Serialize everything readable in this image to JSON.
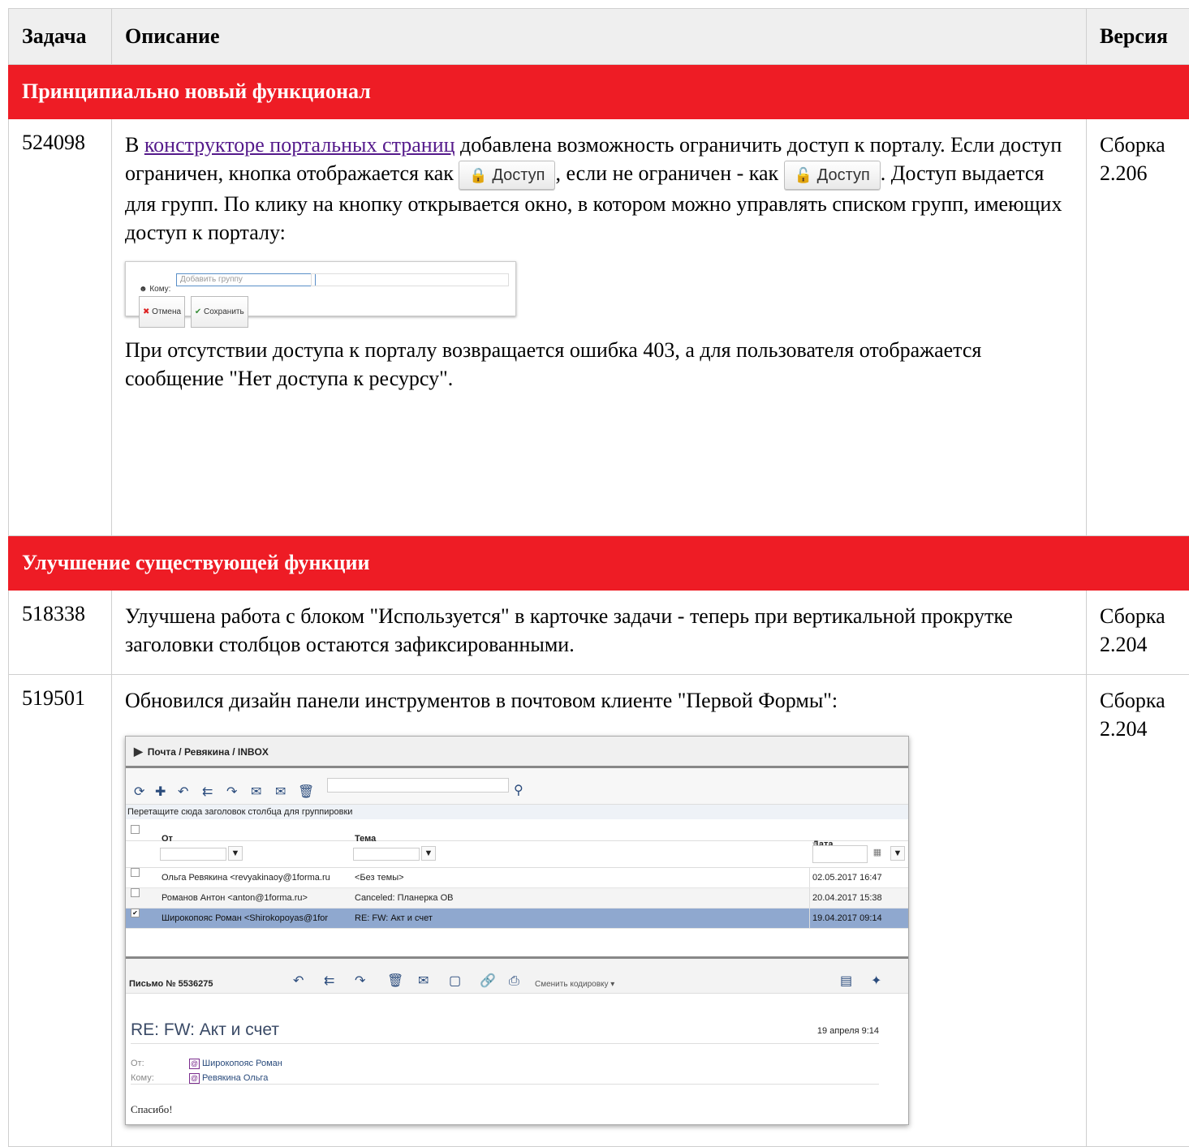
{
  "table": {
    "headers": {
      "task": "Задача",
      "description": "Описание",
      "version": "Версия"
    }
  },
  "sections": [
    {
      "title": "Принципиально новый функционал"
    },
    {
      "title": "Улучшение существующей функции"
    }
  ],
  "rows": {
    "r1": {
      "task": "524098",
      "text_before_link": "В ",
      "link": "конструкторе портальных страниц",
      "text_after_link": " добавлена возможность ограничить доступ к порталу. Если доступ ограничен, кнопка отображается как ",
      "button_locked": "Доступ",
      "text_mid": ", если не ограничен - как ",
      "button_unlocked": "Доступ",
      "text_end": ". Доступ выдается для групп. По клику на кнопку открывается окно, в котором можно управлять списком групп, имеющих доступ к порталу:",
      "dialog": {
        "to_label": "Кому:",
        "placeholder": "Добавить группу",
        "cancel": "Отмена",
        "save": "Сохранить"
      },
      "text_after": "При отсутствии доступа к порталу возвращается ошибка 403, а для пользователя отображается сообщение \"Нет доступа к ресурсу\".",
      "version": "Сборка 2.206"
    },
    "r2": {
      "task": "518338",
      "text": "Улучшена работа с блоком \"Используется\" в карточке задачи - теперь при вертикальной прокрутке заголовки столбцов остаются зафиксированными.",
      "version": "Сборка 2.204"
    },
    "r3": {
      "task": "519501",
      "text": "Обновился дизайн панели инструментов в почтовом клиенте \"Первой Формы\":",
      "version": "Сборка 2.204"
    }
  },
  "mail": {
    "breadcrumb": "Почта / Ревякина / INBOX",
    "group_hint": "Перетащите сюда заголовок столбца для группировки",
    "columns": {
      "from": "От",
      "subject": "Тема",
      "date": "Дата"
    },
    "messages": [
      {
        "from": "Ольга Ревякина <revyakinaoy@1forma.ru",
        "subject": "<Без темы>",
        "date": "02.05.2017 16:47",
        "checked": false
      },
      {
        "from": "Романов Антон <anton@1forma.ru>",
        "subject": "Canceled: Планерка ОВ",
        "date": "20.04.2017 15:38",
        "checked": false
      },
      {
        "from": "Широкопояс Роман <Shirokopoyas@1for",
        "subject": "RE: FW: Акт и счет",
        "date": "19.04.2017 09:14",
        "checked": true
      }
    ],
    "letter_number": "Письмо № 5536275",
    "change_encoding": "Сменить кодировку",
    "subject": "RE: FW: Акт и счет",
    "letter_date": "19 апреля 9:14",
    "from_label": "От:",
    "from_value": "Широкопояс Роман",
    "to_label": "Кому:",
    "to_value": "Ревякина Ольга",
    "body": "Спасибо!"
  }
}
